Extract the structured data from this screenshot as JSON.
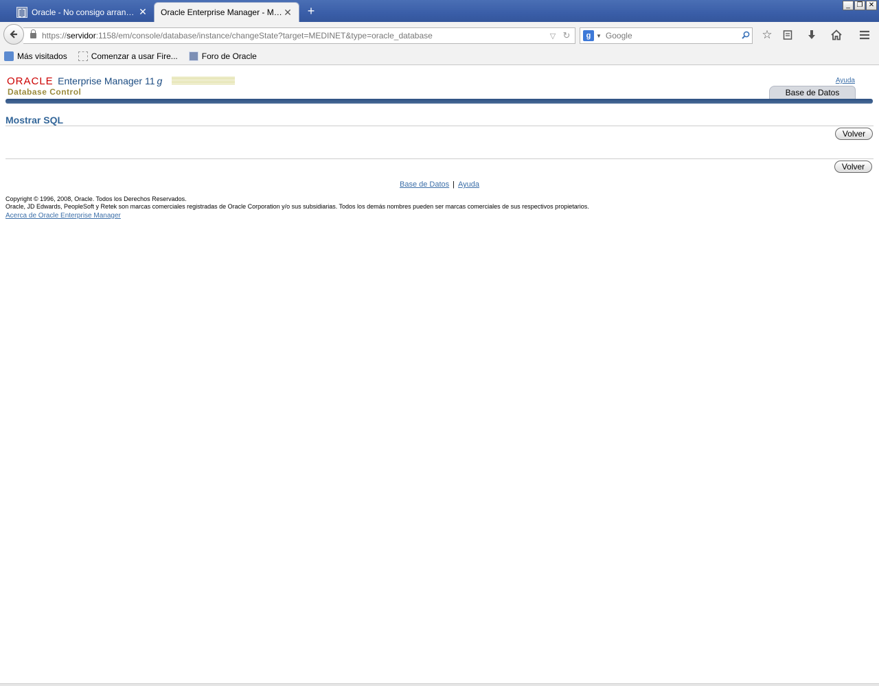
{
  "browser": {
    "tabs": [
      {
        "label": "Oracle - No consigo arrancar ...",
        "close": "✕"
      },
      {
        "label": "Oracle Enterprise Manager - Mostr...",
        "close": "✕"
      }
    ],
    "new_tab": "+",
    "window_controls": [
      "_",
      "❐",
      "✕"
    ],
    "url_prefix": "https://",
    "url_host": "servidor",
    "url_rest": ":1158/em/console/database/instance/changeState?target=MEDINET&type=oracle_database",
    "search_placeholder": "Google",
    "bookmarks": [
      {
        "label": "Más visitados",
        "icon": "visited-icon"
      },
      {
        "label": "Comenzar a usar Fire...",
        "icon": "blank-page-icon"
      },
      {
        "label": "Foro de Oracle",
        "icon": "oracle-favicon-icon"
      }
    ]
  },
  "header": {
    "oracle_word": "ORACLE",
    "product": "Enterprise Manager 11",
    "product_g": "g",
    "subtitle": "Database Control",
    "help_link": "Ayuda",
    "tab_label": "Base de Datos"
  },
  "main": {
    "title": "Mostrar SQL",
    "volver_label": "Volver"
  },
  "footer": {
    "link_db": "Base de Datos",
    "separator": "|",
    "link_help": "Ayuda",
    "copyright_line1": "Copyright © 1996, 2008, Oracle. Todos los Derechos Reservados.",
    "copyright_line2": "Oracle, JD Edwards, PeopleSoft y Retek son marcas comerciales registradas de Oracle Corporation y/o sus subsidiarias. Todos los demás nombres pueden ser marcas comerciales de sus respectivos propietarios.",
    "about_link": "Acerca de Oracle Enterprise Manager"
  },
  "colors": {
    "accent_blue": "#336699",
    "oracle_red": "#cc0000",
    "link": "#3b6ea8",
    "titlebar": "#3a5ea8"
  }
}
